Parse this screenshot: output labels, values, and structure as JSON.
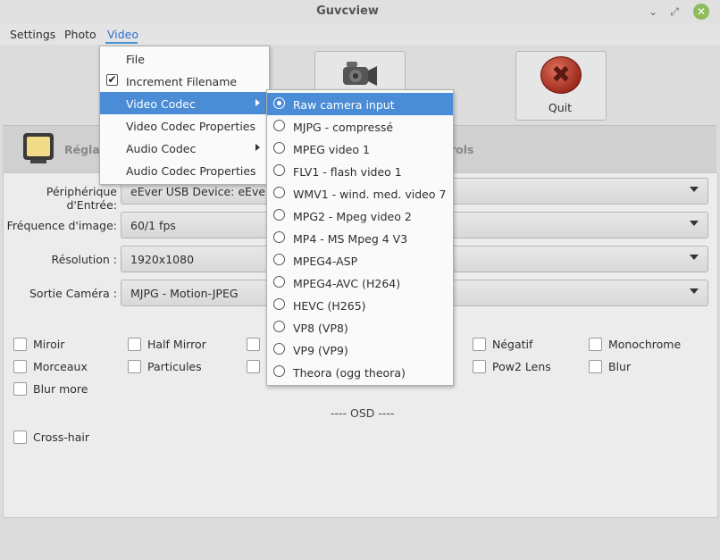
{
  "window": {
    "title": "Guvcview",
    "min_glyph": "⌄",
    "restore_glyph": "⤢",
    "close_glyph": "✕"
  },
  "menubar": {
    "settings": "Settings",
    "photo": "Photo",
    "video": "Video"
  },
  "toolbar": {
    "quit_label": "Quit",
    "quit_glyph": "✖"
  },
  "tabs": {
    "image_controls": "Réglag",
    "video_controls": "rols"
  },
  "fields": {
    "input_device": {
      "label": "Périphérique d'Entrée:",
      "value": "eEver USB Device: eEver US"
    },
    "frame_rate": {
      "label": "Fréquence d'image:",
      "value": "60/1 fps"
    },
    "resolution": {
      "label": "Résolution :",
      "value": "1920x1080"
    },
    "camera_output": {
      "label": "Sortie Caméra :",
      "value": "MJPG - Motion-JPEG"
    }
  },
  "filters": {
    "row1": [
      "Miroir",
      "Half Mirror",
      "Négatif",
      "Monochrome"
    ],
    "row2": [
      "Morceaux",
      "Particules",
      "Pow2 Lens",
      "Blur"
    ],
    "row3": [
      "Blur more"
    ]
  },
  "osd": {
    "heading": "---- OSD ----",
    "crosshair": "Cross-hair"
  },
  "video_menu": {
    "file": "File",
    "increment_filename": "Increment Filename",
    "increment_checked": true,
    "video_codec": "Video Codec",
    "video_codec_properties": "Video Codec Properties",
    "audio_codec": "Audio Codec",
    "audio_codec_properties": "Audio Codec Properties",
    "check_glyph": "✔"
  },
  "codec_menu": {
    "selected_index": 0,
    "items": [
      "Raw camera input",
      "MJPG - compressé",
      "MPEG video 1",
      "FLV1 - flash video 1",
      "WMV1 - wind. med. video 7",
      "MPG2 - Mpeg video 2",
      "MP4 - MS Mpeg 4 V3",
      "MPEG4-ASP",
      "MPEG4-AVC (H264)",
      "HEVC (H265)",
      "VP8 (VP8)",
      "VP9 (VP9)",
      "Theora (ogg theora)"
    ]
  },
  "colors": {
    "accent": "#4a8cd6",
    "menu_active": "#2f6fd0",
    "close_button": "#8fbc5a"
  }
}
